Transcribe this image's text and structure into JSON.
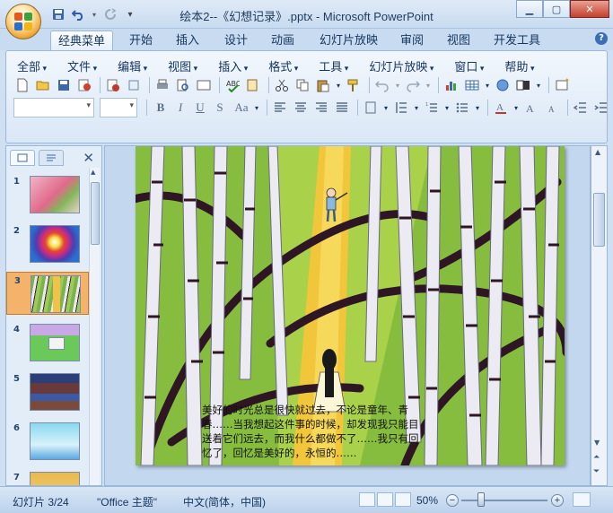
{
  "window": {
    "title": "绘本2--《幻想记录》.pptx - Microsoft PowerPoint"
  },
  "ribbon_tabs": [
    "经典菜单",
    "开始",
    "插入",
    "设计",
    "动画",
    "幻灯片放映",
    "审阅",
    "视图",
    "开发工具"
  ],
  "menus": [
    "全部",
    "文件",
    "编辑",
    "视图",
    "插入",
    "格式",
    "工具",
    "幻灯片放映",
    "窗口",
    "帮助"
  ],
  "format_buttons": [
    "B",
    "I",
    "U",
    "S",
    "Aa"
  ],
  "slides": {
    "numbers": [
      "1",
      "2",
      "3",
      "4",
      "5",
      "6",
      "7"
    ],
    "active_index": 3
  },
  "slide": {
    "caption": "美好的时光总是很快就过去，不论是童年、青春……当我想起这件事的时候，却发现我只能目送着它们远去，而我什么都做不了……我只有回忆了，回忆是美好的，永恒的……"
  },
  "status": {
    "slide_pos": "幻灯片 3/24",
    "theme": "\"Office 主题\"",
    "language": "中文(简体，中国)",
    "zoom": "50%"
  },
  "colors": {
    "accent": "#3a6fb7",
    "active_thumb": "#f4b26b"
  }
}
